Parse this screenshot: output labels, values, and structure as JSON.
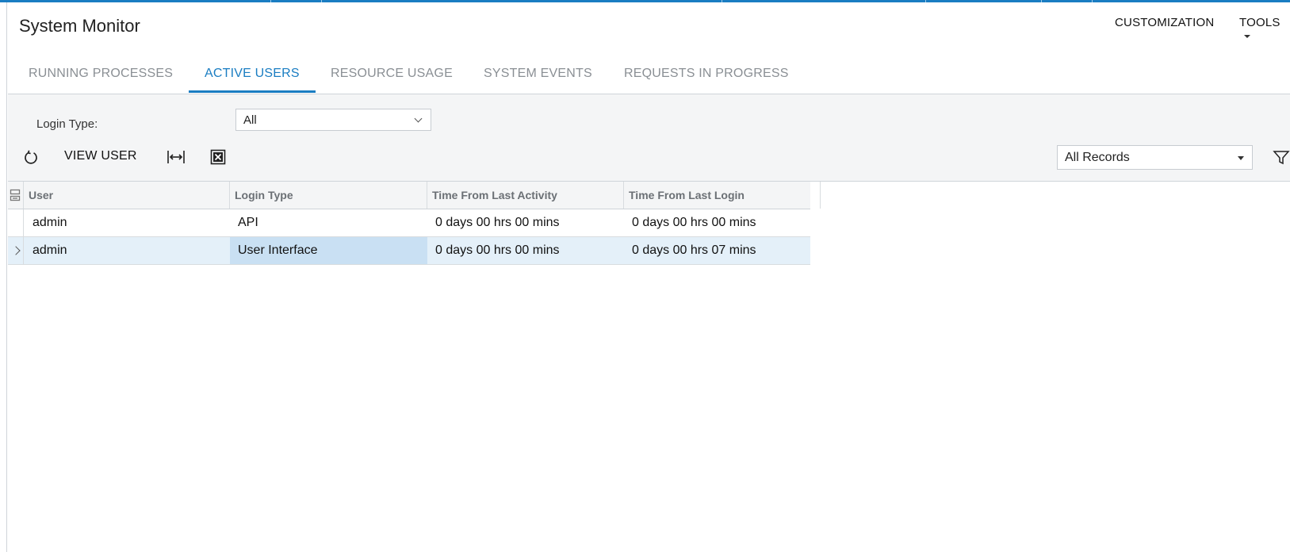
{
  "page": {
    "title": "System Monitor"
  },
  "top_menu": {
    "customization": "CUSTOMIZATION",
    "tools": "TOOLS"
  },
  "tabs": [
    {
      "label": "RUNNING PROCESSES",
      "active": false
    },
    {
      "label": "ACTIVE USERS",
      "active": true
    },
    {
      "label": "RESOURCE USAGE",
      "active": false
    },
    {
      "label": "SYSTEM EVENTS",
      "active": false
    },
    {
      "label": "REQUESTS IN PROGRESS",
      "active": false
    }
  ],
  "filter": {
    "label": "Login Type:",
    "value": "All"
  },
  "toolbar": {
    "refresh_icon": "refresh-icon",
    "view_user_label": "VIEW USER",
    "fit_columns_icon": "fit-columns-icon",
    "export_excel_icon": "export-excel-icon",
    "records_filter_value": "All Records",
    "filter_icon": "filter-icon"
  },
  "table": {
    "columns": [
      "User",
      "Login Type",
      "Time From Last Activity",
      "Time From Last Login"
    ],
    "rows": [
      {
        "user": "admin",
        "login_type": "API",
        "last_activity": "0 days 00 hrs 00 mins",
        "last_login": "0 days 00 hrs 00 mins",
        "selected": false
      },
      {
        "user": "admin",
        "login_type": "User Interface",
        "last_activity": "0 days 00 hrs 00 mins",
        "last_login": "0 days 00 hrs 07 mins",
        "selected": true
      }
    ]
  },
  "colors": {
    "accent": "#1a7dc2",
    "panel_bg": "#f4f5f6",
    "selected_row": "#e4f0f9",
    "selected_cell": "#c9e0f3"
  }
}
